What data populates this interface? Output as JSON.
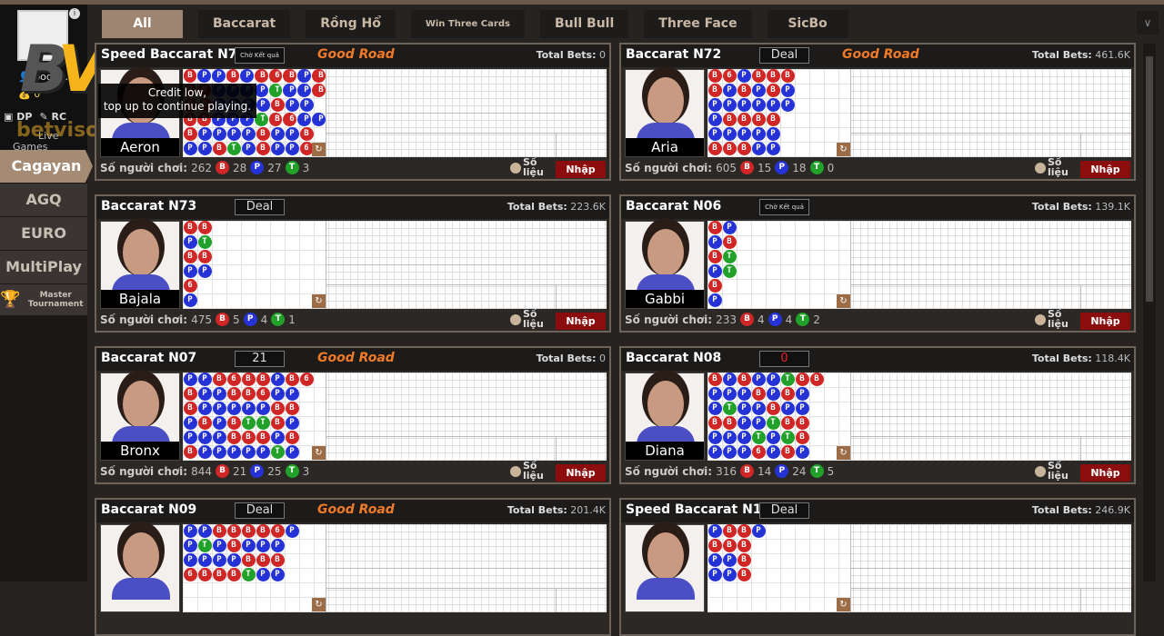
{
  "user": {
    "name": "bodir...",
    "balance": "0",
    "dp": "DP",
    "rc": "RC",
    "live_games": "Live Games"
  },
  "watermark": {
    "logo": "BV",
    "site": "betviso.fyi"
  },
  "sidebar": {
    "items": [
      {
        "label": "Cagayan",
        "active": true
      },
      {
        "label": "AGQ"
      },
      {
        "label": "EURO"
      },
      {
        "label": "MultiPlay"
      },
      {
        "label": "Master Tournament",
        "icon": "trophy-icon"
      }
    ]
  },
  "tabs": [
    {
      "label": "All",
      "active": true
    },
    {
      "label": "Baccarat"
    },
    {
      "label": "Rồng Hổ"
    },
    {
      "label": "Win Three Cards",
      "small": true
    },
    {
      "label": "Bull Bull"
    },
    {
      "label": "Three Face"
    },
    {
      "label": "SicBo"
    }
  ],
  "tooltip": {
    "line1": "Credit low,",
    "line2": "top up to continue playing."
  },
  "labels": {
    "players": "Số người chơi:",
    "total_bets": "Total Bets:",
    "stats": "Số liệu",
    "enter": "Nhập",
    "good_road": "Good Road"
  },
  "colors": {
    "banker": "#d02626",
    "player": "#2533d6",
    "tie": "#21a12a",
    "accent": "#f07a28",
    "enter": "#8b0d0d"
  },
  "tables": [
    {
      "title": "Speed Baccarat N71",
      "status": "Chờ Kết quả",
      "status_type": "small",
      "good_road": true,
      "total_bets": "0",
      "dealer": "Aeron",
      "players": "262",
      "b": "28",
      "p": "27",
      "t": "3",
      "bead": [
        "BPPBPB6BPB",
        "BBPPPPTPPB",
        "BBPPPPBPP",
        "BBPPPTB6PP",
        "BPPPPBPPB",
        "PPBTPBPP6"
      ]
    },
    {
      "title": "Baccarat N72",
      "status": "Deal",
      "good_road": true,
      "total_bets": "461.6K",
      "dealer": "Aria",
      "players": "605",
      "b": "15",
      "p": "18",
      "t": "0",
      "bead": [
        "B6PBBB",
        "BPBPBP",
        "PPPPPP",
        "PBBBB",
        "PPPPP",
        "BBBPP"
      ]
    },
    {
      "title": "Baccarat N73",
      "status": "Deal",
      "good_road": false,
      "total_bets": "223.6K",
      "dealer": "Bajala",
      "players": "475",
      "b": "5",
      "p": "4",
      "t": "1",
      "bead": [
        "BB",
        "PT",
        "BB",
        "PP",
        "6",
        "P"
      ]
    },
    {
      "title": "Baccarat N06",
      "status": "Chờ Kết quả",
      "status_type": "small",
      "good_road": false,
      "total_bets": "139.1K",
      "dealer": "Gabbi",
      "players": "233",
      "b": "4",
      "p": "4",
      "t": "2",
      "bead": [
        "BP",
        "PB",
        "BT",
        "PT",
        "B",
        "P"
      ]
    },
    {
      "title": "Baccarat N07",
      "status": "21",
      "good_road": true,
      "total_bets": "0",
      "dealer": "Bronx",
      "players": "844",
      "b": "21",
      "p": "25",
      "t": "3",
      "bead": [
        "PPB6BBPB6",
        "BPPBB6PP",
        "BPPPPPBB",
        "PBPBTTBP",
        "PPPBBBPB",
        "BPPPPPTP"
      ]
    },
    {
      "title": "Baccarat N08",
      "status": "0",
      "status_type": "red",
      "good_road": false,
      "total_bets": "118.4K",
      "dealer": "Diana",
      "players": "316",
      "b": "14",
      "p": "24",
      "t": "5",
      "bead": [
        "BPBPPTBB",
        "PPPBPBP",
        "PTPPBPP",
        "BBPPTBB",
        "PPPTPTB",
        "PPP6PBP"
      ]
    },
    {
      "title": "Baccarat N09",
      "status": "Deal",
      "good_road": true,
      "total_bets": "201.4K",
      "dealer": "",
      "players": "",
      "b": "",
      "p": "",
      "t": "",
      "bead": [
        "PPBBBB6P",
        "PTPBPPP",
        "PPPPBBB",
        "6BBBTPP"
      ]
    },
    {
      "title": "Speed Baccarat N10",
      "status": "Deal",
      "good_road": false,
      "total_bets": "246.9K",
      "dealer": "",
      "players": "",
      "b": "",
      "p": "",
      "t": "",
      "bead": [
        "PBBP",
        "BBB",
        "PPB",
        "PPB"
      ]
    }
  ]
}
